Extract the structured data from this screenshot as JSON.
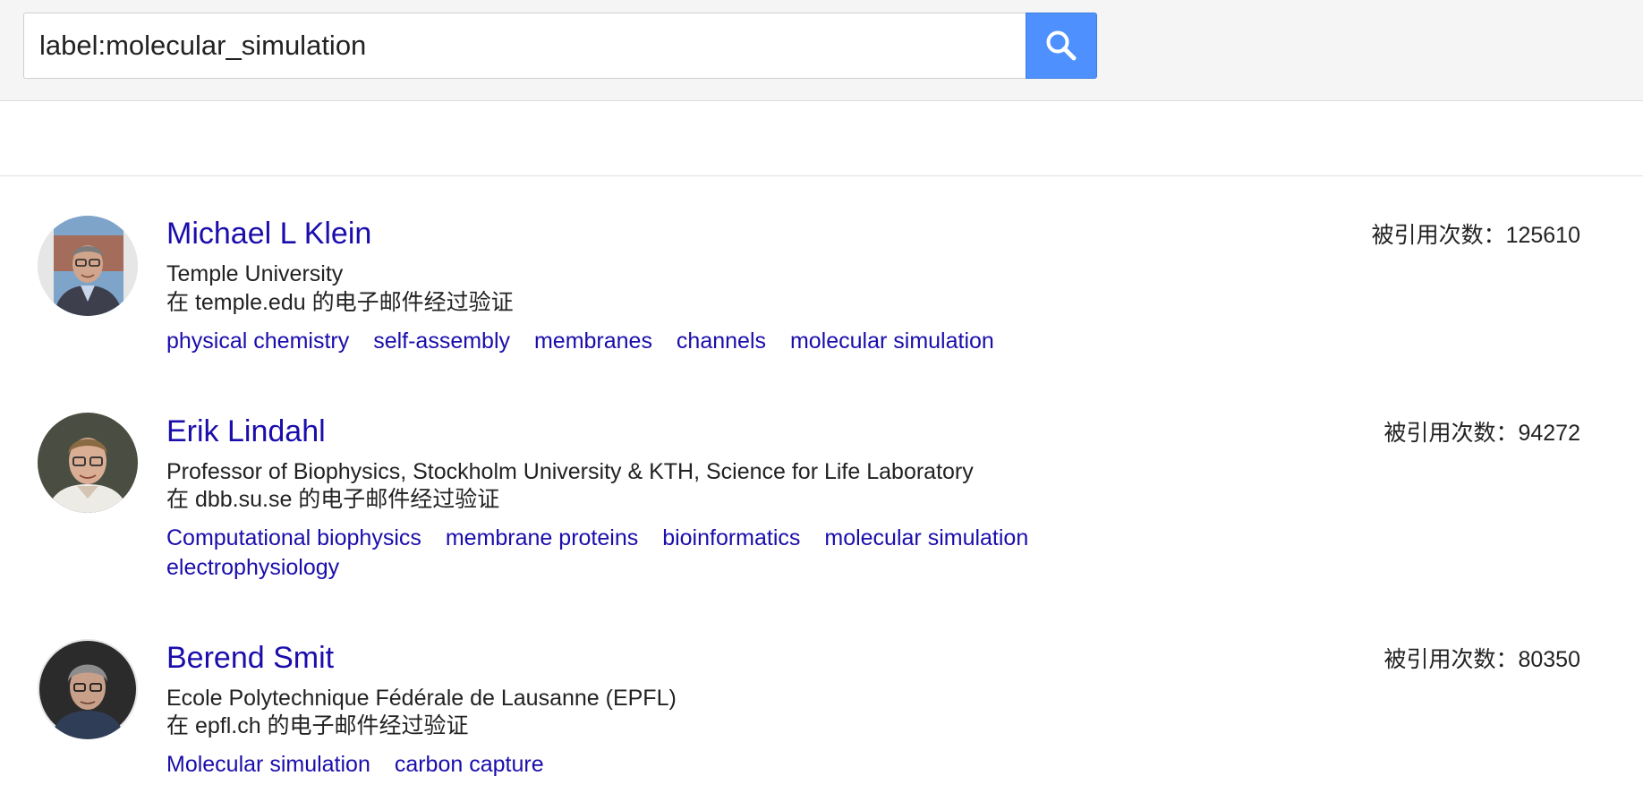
{
  "search": {
    "query": "label:molecular_simulation"
  },
  "colors": {
    "accent": "#4d90fe",
    "link": "#1a0dab",
    "text": "#222222",
    "topbar_bg": "#f5f5f5"
  },
  "icons": {
    "search_button": "search-icon"
  },
  "results": [
    {
      "name": "Michael L Klein",
      "citations": "被引用次数：125610",
      "affiliation": "Temple University",
      "email_verified": "在 temple.edu 的电子邮件经过验证",
      "interests": [
        "physical chemistry",
        "self-assembly",
        "membranes",
        "channels",
        "molecular simulation"
      ]
    },
    {
      "name": "Erik Lindahl",
      "citations": "被引用次数：94272",
      "affiliation": "Professor of Biophysics, Stockholm University & KTH, Science for Life Laboratory",
      "email_verified": "在 dbb.su.se 的电子邮件经过验证",
      "interests": [
        "Computational biophysics",
        "membrane proteins",
        "bioinformatics",
        "molecular simulation",
        "electrophysiology"
      ]
    },
    {
      "name": "Berend Smit",
      "citations": "被引用次数：80350",
      "affiliation": "Ecole Polytechnique Fédérale de Lausanne (EPFL)",
      "email_verified": "在 epfl.ch 的电子邮件经过验证",
      "interests": [
        "Molecular simulation",
        "carbon capture"
      ]
    }
  ]
}
